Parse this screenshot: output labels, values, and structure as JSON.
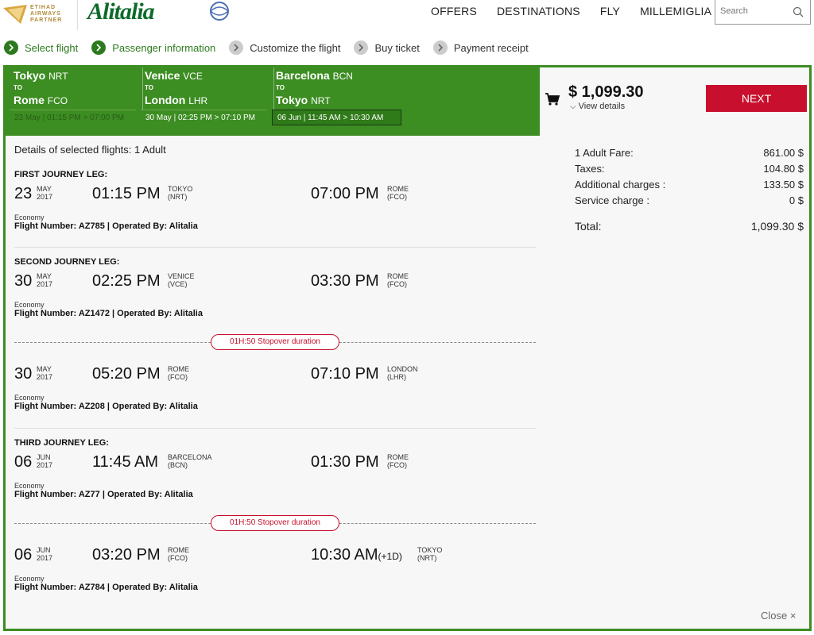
{
  "header": {
    "etihad": [
      "ETIHAD",
      "AIRWAYS",
      "PARTNER"
    ],
    "brand": "Alitalia",
    "nav": [
      "OFFERS",
      "DESTINATIONS",
      "FLY",
      "MILLEMIGLIA"
    ],
    "search_placeholder": "Search"
  },
  "steps": [
    {
      "label": "Select flight",
      "state": "done"
    },
    {
      "label": "Passenger information",
      "state": "done"
    },
    {
      "label": "Customize the flight",
      "state": "todo"
    },
    {
      "label": "Buy ticket",
      "state": "todo"
    },
    {
      "label": "Payment receipt",
      "state": "todo"
    }
  ],
  "legs": [
    {
      "from": "Tokyo",
      "from_code": "NRT",
      "to_label": "TO",
      "to": "Rome",
      "to_code": "FCO",
      "time": "23 May | 01:15 PM > 07:00 PM"
    },
    {
      "from": "Venice",
      "from_code": "VCE",
      "to_label": "TO",
      "to": "London",
      "to_code": "LHR",
      "time": "30 May | 02:25 PM > 07:10 PM"
    },
    {
      "from": "Barcelona",
      "from_code": "BCN",
      "to_label": "TO",
      "to": "Tokyo",
      "to_code": "NRT",
      "time": "06 Jun | 11:45 AM > 10:30 AM"
    }
  ],
  "summary": {
    "price": "$ 1,099.30",
    "view_details": "View details",
    "next": "NEXT"
  },
  "fare": {
    "rows": [
      {
        "label": "1 Adult Fare:",
        "value": "861.00 $"
      },
      {
        "label": "Taxes:",
        "value": "104.80 $"
      },
      {
        "label": "Additional charges :",
        "value": "133.50 $"
      },
      {
        "label": "Service charge :",
        "value": "0 $"
      }
    ],
    "total_label": "Total:",
    "total_value": "1,099.30 $"
  },
  "details": {
    "heading": "Details of selected flights: 1 Adult",
    "leg_titles": [
      "FIRST JOURNEY LEG:",
      "SECOND JOURNEY LEG:",
      "THIRD JOURNEY LEG:"
    ],
    "segments": [
      {
        "day": "23",
        "month": "MAY",
        "year": "2017",
        "dep": "01:15 PM",
        "dep_city": "TOKYO",
        "dep_code": "(NRT)",
        "arr": "07:00 PM",
        "arr_plus": "",
        "arr_city": "ROME",
        "arr_code": "(FCO)",
        "class": "Economy",
        "flight": "Flight Number: AZ785 | Operated By: Alitalia"
      },
      {
        "day": "30",
        "month": "MAY",
        "year": "2017",
        "dep": "02:25 PM",
        "dep_city": "VENICE",
        "dep_code": "(VCE)",
        "arr": "03:30 PM",
        "arr_plus": "",
        "arr_city": "ROME",
        "arr_code": "(FCO)",
        "class": "Economy",
        "flight": "Flight Number: AZ1472 | Operated By: Alitalia"
      },
      {
        "day": "30",
        "month": "MAY",
        "year": "2017",
        "dep": "05:20 PM",
        "dep_city": "ROME",
        "dep_code": "(FCO)",
        "arr": "07:10 PM",
        "arr_plus": "",
        "arr_city": "LONDON",
        "arr_code": "(LHR)",
        "class": "Economy",
        "flight": "Flight Number: AZ208 | Operated By: Alitalia"
      },
      {
        "day": "06",
        "month": "JUN",
        "year": "2017",
        "dep": "11:45 AM",
        "dep_city": "BARCELONA",
        "dep_code": "(BCN)",
        "arr": "01:30 PM",
        "arr_plus": "",
        "arr_city": "ROME",
        "arr_code": "(FCO)",
        "class": "Economy",
        "flight": "Flight Number: AZ77 | Operated By: Alitalia"
      },
      {
        "day": "06",
        "month": "JUN",
        "year": "2017",
        "dep": "03:20 PM",
        "dep_city": "ROME",
        "dep_code": "(FCO)",
        "arr": "10:30 AM",
        "arr_plus": "(+1D)",
        "arr_city": "TOKYO",
        "arr_code": "(NRT)",
        "class": "Economy",
        "flight": "Flight Number: AZ784 | Operated By: Alitalia"
      }
    ],
    "stopover": [
      "01H:50 Stopover duration",
      "01H:50 Stopover duration"
    ]
  },
  "close": "Close ×",
  "colors": {
    "green": "#3c8d22",
    "red": "#c8102e",
    "brand_green": "#0d6b2b"
  }
}
